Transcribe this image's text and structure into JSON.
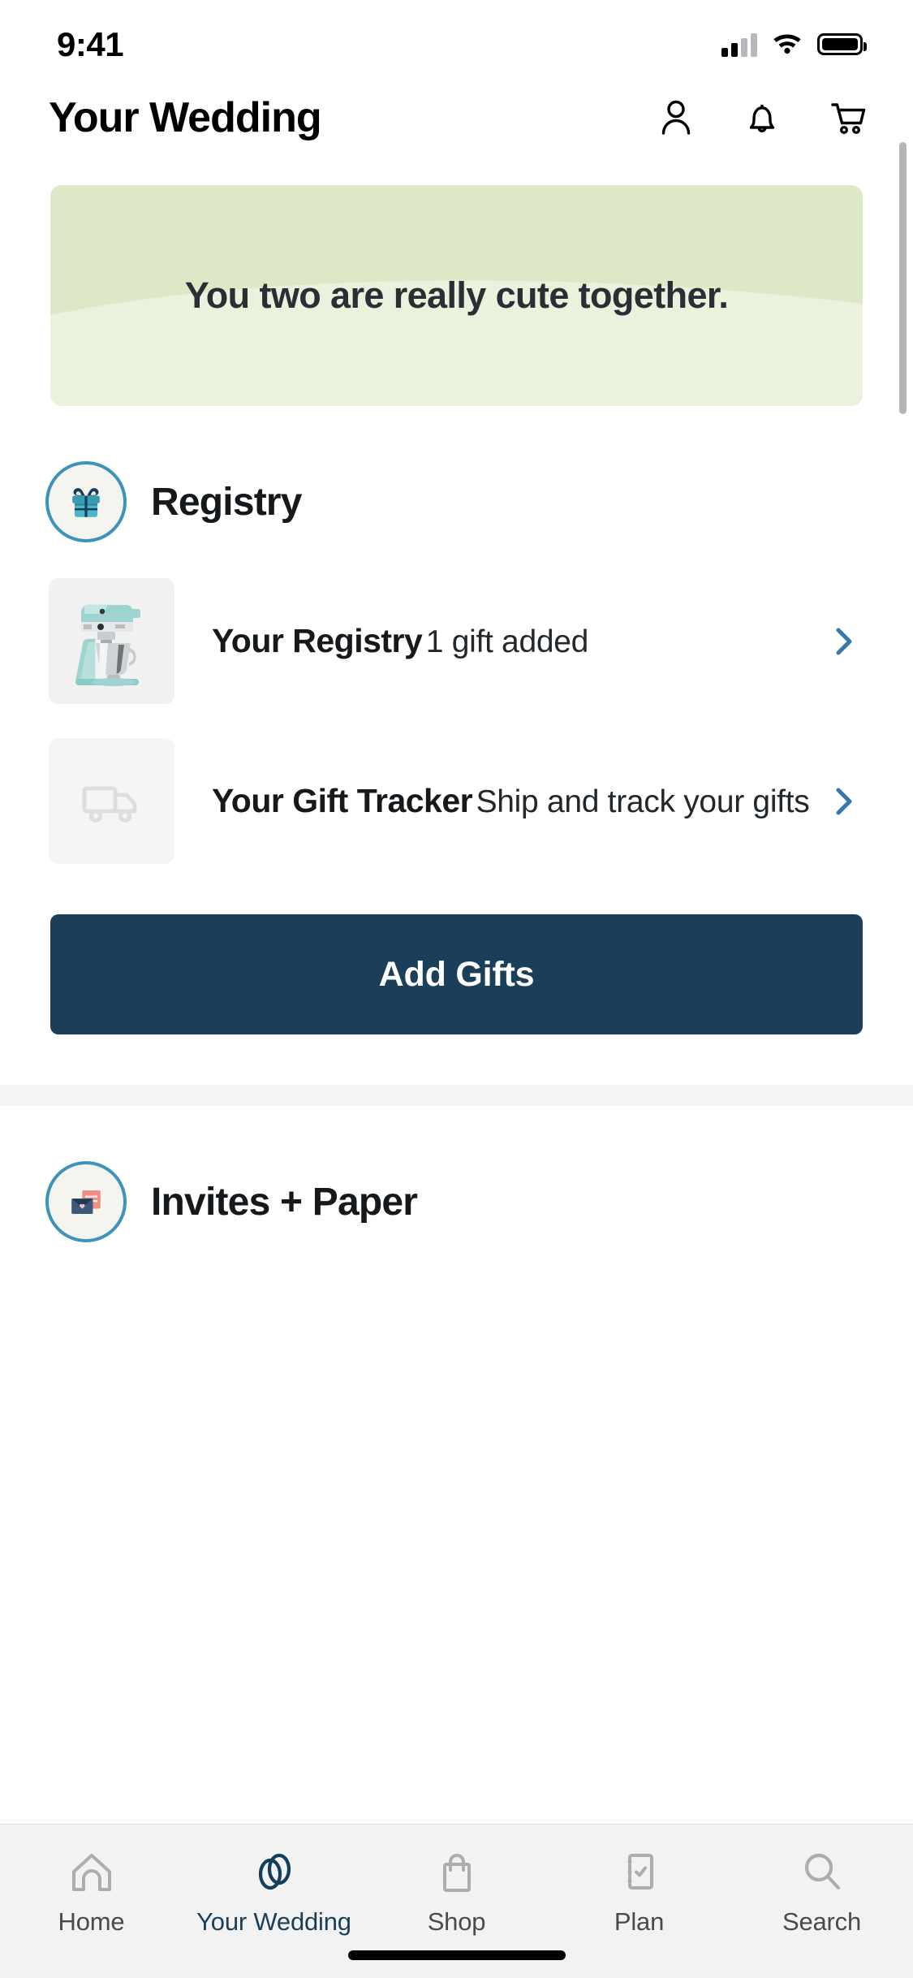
{
  "status_bar": {
    "time": "9:41",
    "signal_icon": "cellular-signal-icon",
    "wifi_icon": "wifi-icon",
    "battery_icon": "battery-full-icon"
  },
  "header": {
    "title": "Your Wedding",
    "actions": [
      {
        "name": "profile-icon",
        "label": "Profile"
      },
      {
        "name": "notifications-bell-icon",
        "label": "Notifications"
      },
      {
        "name": "shopping-cart-icon",
        "label": "Cart"
      }
    ]
  },
  "banner": {
    "text": "You two are really cute together.",
    "bg_color": "#dde8c6",
    "wave_color": "#eaf1dc",
    "text_color": "#2a2f33"
  },
  "sections": [
    {
      "title": "Registry",
      "icon": "gift-box-icon",
      "icon_ring_color": "#3e93bb",
      "rows": [
        {
          "title": "Your Registry",
          "subtitle": "1 gift added",
          "thumb": "stand-mixer-photo",
          "chevron": "chevron-right-icon"
        },
        {
          "title": "Your Gift Tracker",
          "subtitle": "Ship and track your gifts",
          "thumb": "delivery-truck-icon",
          "chevron": "chevron-right-icon"
        }
      ],
      "button": {
        "label": "Add Gifts",
        "bg_color": "#1b3f58",
        "text_color": "#ffffff"
      }
    },
    {
      "title": "Invites + Paper",
      "icon": "envelope-card-icon",
      "icon_ring_color": "#3e93bb",
      "rows": [],
      "button": null
    }
  ],
  "tab_bar": {
    "active_color": "#1b3f58",
    "inactive_color": "#4a4a4a",
    "tabs": [
      {
        "label": "Home",
        "icon": "home-icon",
        "active": false
      },
      {
        "label": "Your Wedding",
        "icon": "wedding-rings-icon",
        "active": true
      },
      {
        "label": "Shop",
        "icon": "shopping-bag-icon",
        "active": false
      },
      {
        "label": "Plan",
        "icon": "checklist-icon",
        "active": false
      },
      {
        "label": "Search",
        "icon": "search-icon",
        "active": false
      }
    ]
  }
}
